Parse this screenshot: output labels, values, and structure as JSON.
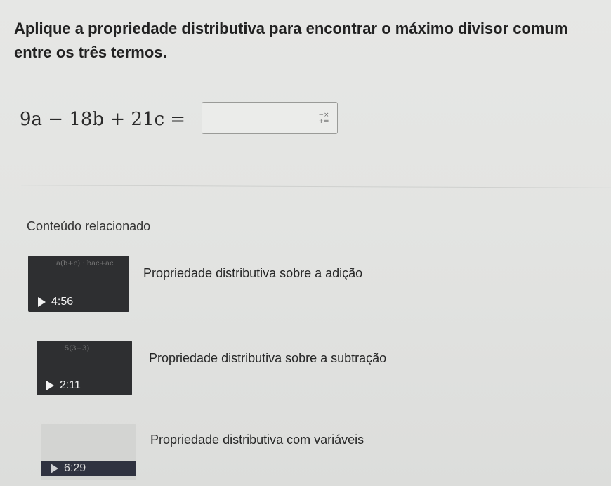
{
  "question": {
    "text": "Aplique a propriedade distributiva para encontrar o máximo divisor comum entre os três termos."
  },
  "equation": {
    "expression": "9a − 18b + 21c =",
    "answer_value": "",
    "keypad_icon": "math-keypad-icon"
  },
  "related": {
    "heading": "Conteúdo relacionado",
    "videos": [
      {
        "title": "Propriedade distributiva sobre a adição",
        "duration": "4:56"
      },
      {
        "title": "Propriedade distributiva sobre a subtração",
        "duration": "2:11"
      },
      {
        "title": "Propriedade distributiva com variáveis",
        "duration": "6:29"
      }
    ]
  }
}
